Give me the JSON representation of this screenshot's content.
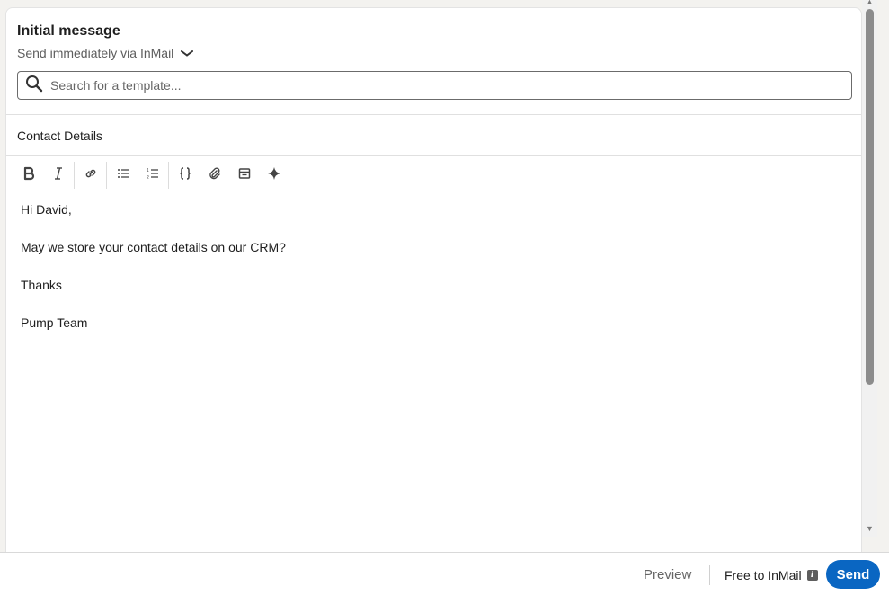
{
  "header": {
    "title": "Initial message",
    "send_mode": "Send immediately via InMail"
  },
  "search": {
    "placeholder": "Search for a template..."
  },
  "subject": "Contact Details",
  "toolbar": {
    "icons": [
      "bold-icon",
      "italic-icon",
      "link-icon",
      "bulleted-list-icon",
      "numbered-list-icon",
      "variables-icon",
      "attachment-icon",
      "template-icon",
      "ai-sparkle-icon"
    ]
  },
  "message": {
    "lines": [
      "Hi David,",
      "May we store your contact details on our CRM?",
      "Thanks",
      "Pump Team"
    ]
  },
  "footer": {
    "preview_label": "Preview",
    "free_label": "Free to InMail",
    "send_label": "Send"
  },
  "colors": {
    "accent": "#0a66c2"
  }
}
